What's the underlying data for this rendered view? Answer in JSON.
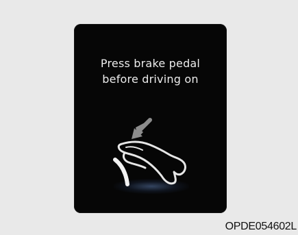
{
  "display": {
    "message_line1": "Press brake pedal",
    "message_line2": "before driving on",
    "icons": [
      "arrow-down-left-icon",
      "foot-on-brake-pedal-icon"
    ]
  },
  "figure": {
    "code": "OPDE054602L"
  },
  "colors": {
    "page_background": "#ebebeb",
    "screen_background": "#060606",
    "text": "#ececec",
    "glow": "#5a78aa"
  }
}
